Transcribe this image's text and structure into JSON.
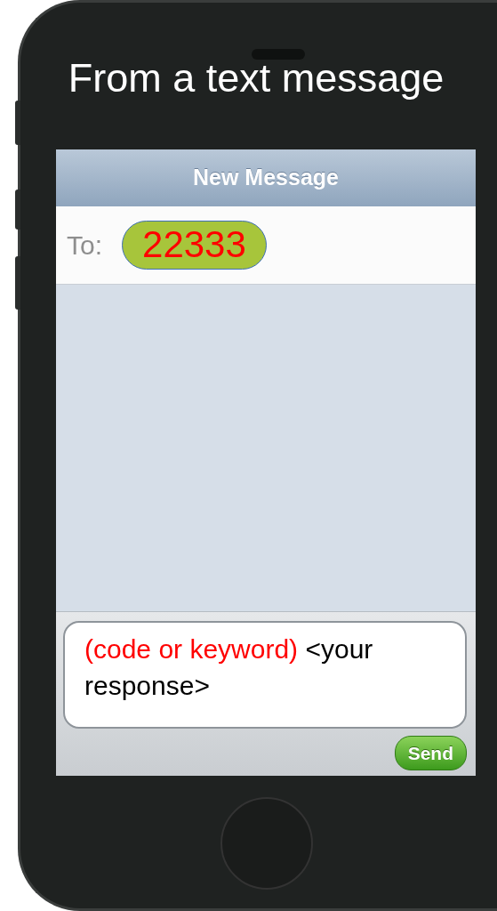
{
  "caption": "From a text message",
  "screen": {
    "title": "New Message",
    "to_label": "To:",
    "recipient": "22333",
    "compose": [
      {
        "text": "(code or keyword)",
        "color": "#ff0000"
      },
      {
        "text": "<your response>",
        "color": "#000000"
      }
    ],
    "send_button": "Send"
  }
}
